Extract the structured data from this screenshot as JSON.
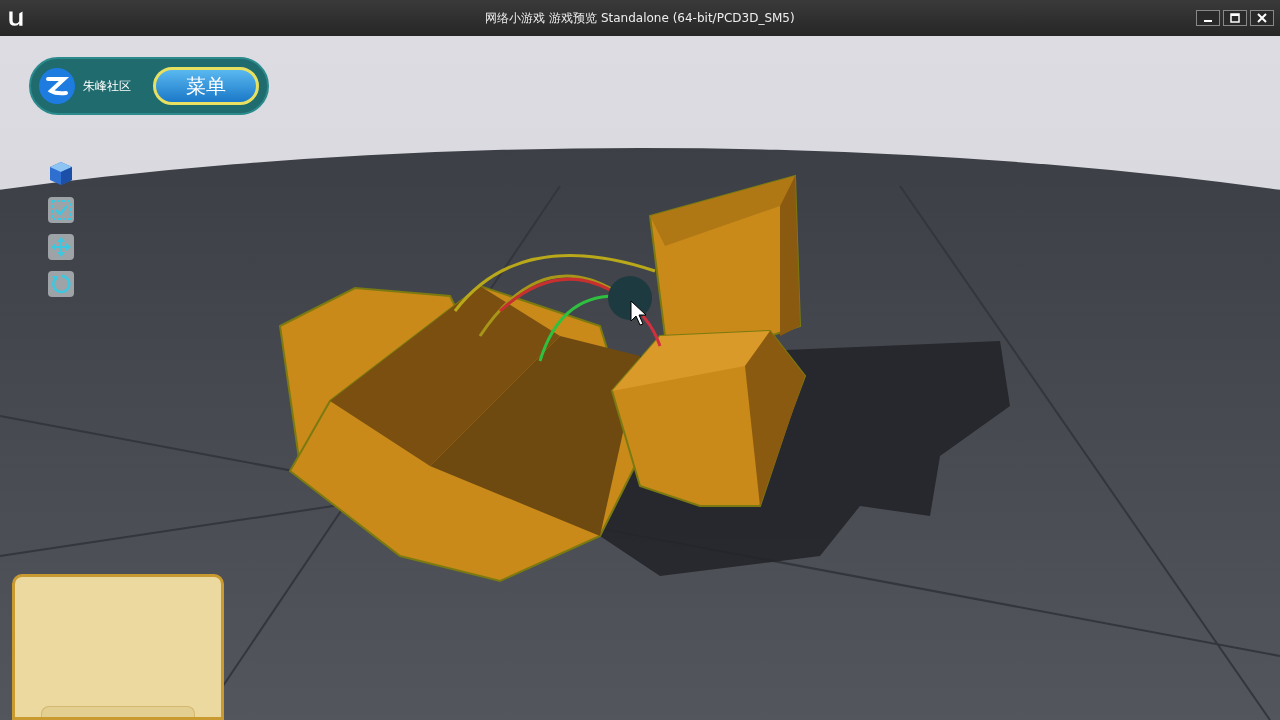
{
  "window": {
    "title": "网络小游戏 游戏预览 Standalone (64-bit/PCD3D_SM5)"
  },
  "hud": {
    "community_label": "朱峰社区",
    "menu_button": "菜单"
  },
  "tools": [
    {
      "kind": "cube"
    },
    {
      "kind": "select"
    },
    {
      "kind": "move"
    },
    {
      "kind": "rotate"
    }
  ]
}
